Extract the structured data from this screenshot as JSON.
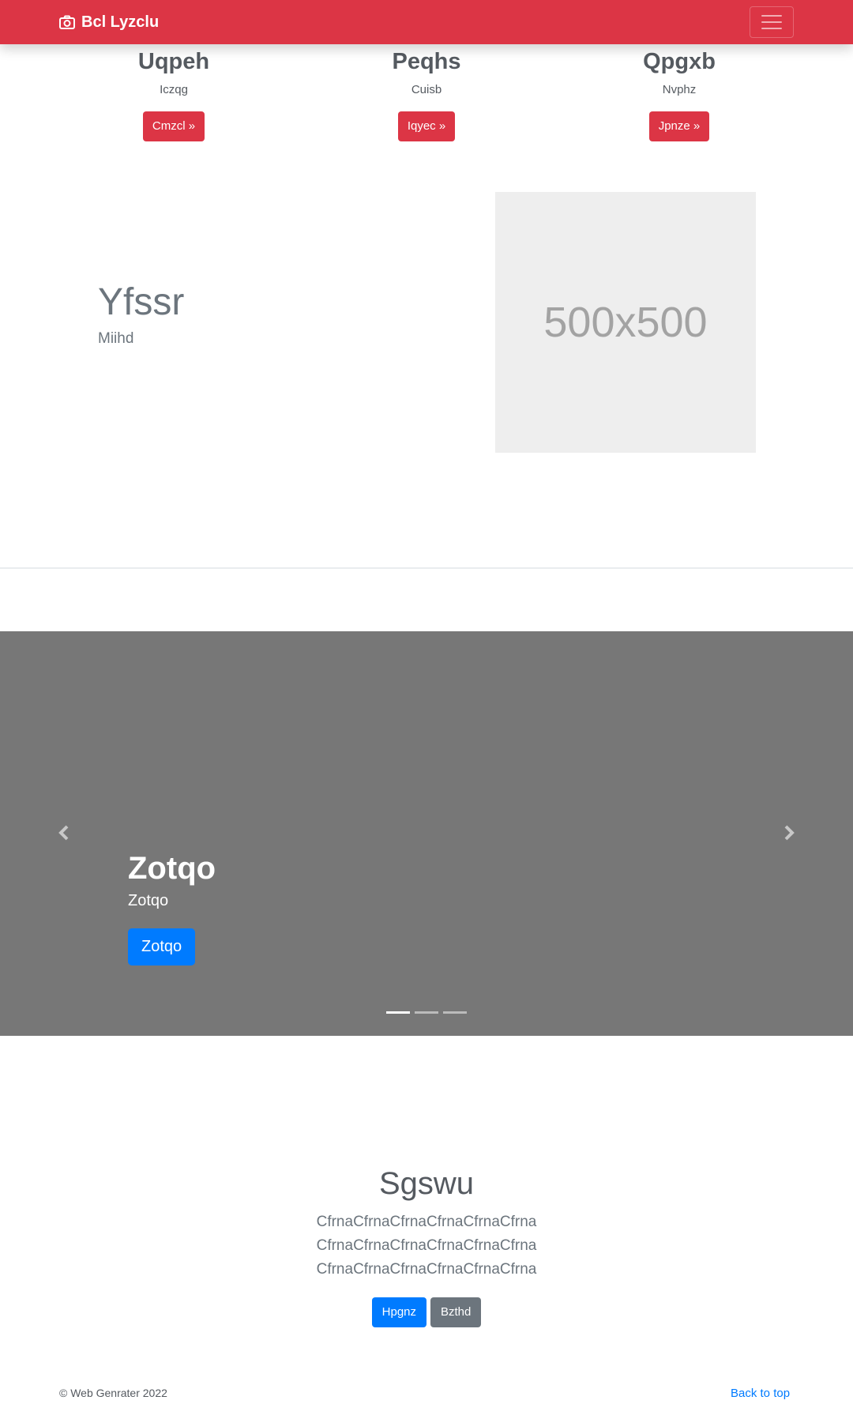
{
  "navbar": {
    "brand": "Bcl Lyzclu",
    "brand_icon": "camera-icon",
    "toggler_icon": "hamburger-menu-icon",
    "color": "#dc3545"
  },
  "features": [
    {
      "title": "Uqpeh",
      "subtitle": "Iczqg",
      "button": "Cmzcl »"
    },
    {
      "title": "Peqhs",
      "subtitle": "Cuisb",
      "button": "Iqyec »"
    },
    {
      "title": "Qpgxb",
      "subtitle": "Nvphz",
      "button": "Jpnze »"
    }
  ],
  "featurette": {
    "heading": "Yfssr",
    "subheading": "Miihd",
    "placeholder_text": "500x500"
  },
  "carousel": {
    "title": "Zotqo",
    "text": "Zotqo",
    "button": "Zotqo",
    "prev_icon": "chevron-left-icon",
    "next_icon": "chevron-right-icon",
    "slide_count": 3,
    "active_slide": 1,
    "background": "#777777"
  },
  "hero": {
    "title": "Sgswu",
    "text": "CfrnaCfrnaCfrnaCfrnaCfrnaCfrna CfrnaCfrnaCfrnaCfrnaCfrnaCfrna CfrnaCfrnaCfrnaCfrnaCfrnaCfrna",
    "primary_button": "Hpgnz",
    "secondary_button": "Bzthd"
  },
  "footer": {
    "copyright": "© Web Genrater 2022",
    "back_to_top": "Back to top"
  }
}
